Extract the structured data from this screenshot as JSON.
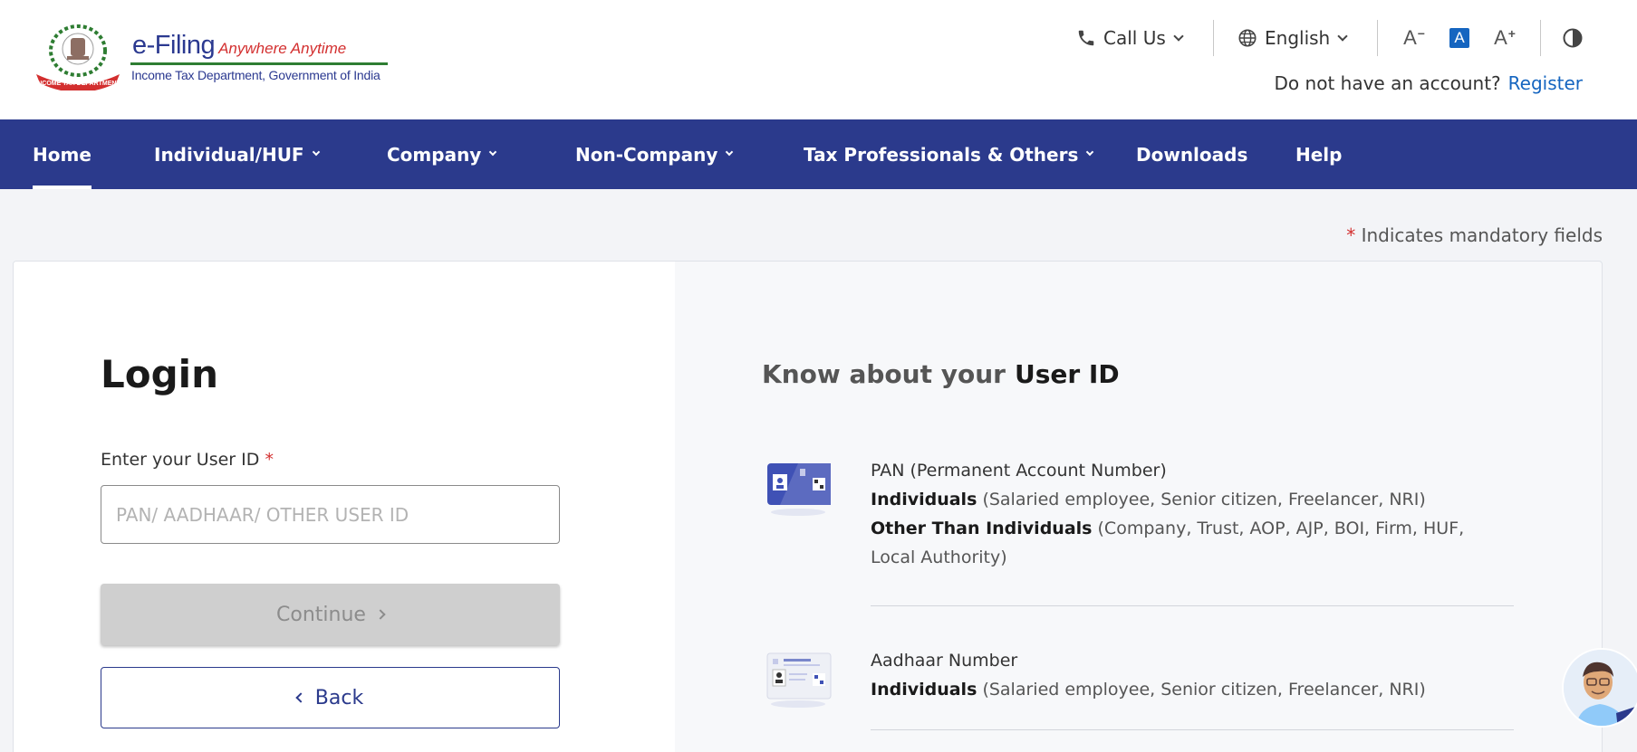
{
  "header": {
    "logo": {
      "title": "e-Filing",
      "tagline": "Anywhere Anytime",
      "subtitle": "Income Tax Department, Government of India",
      "emblem_ribbon_text": "INCOME TAX DEPARTMENT"
    },
    "call_us_label": "Call Us",
    "language_label": "English",
    "font_decrease_label": "A",
    "font_reset_label": "A",
    "font_increase_label": "A",
    "account_prompt": "Do not have an account?",
    "register_label": "Register"
  },
  "nav": {
    "items": [
      {
        "label": "Home",
        "active": true,
        "dropdown": false
      },
      {
        "label": "Individual/HUF",
        "dropdown": true
      },
      {
        "label": "Company",
        "dropdown": true
      },
      {
        "label": "Non-Company",
        "dropdown": true
      },
      {
        "label": "Tax Professionals & Others",
        "dropdown": true
      },
      {
        "label": "Downloads",
        "dropdown": false
      },
      {
        "label": "Help",
        "dropdown": false
      }
    ]
  },
  "main": {
    "mandatory_star": "*",
    "mandatory_note": "Indicates mandatory fields",
    "login": {
      "title": "Login",
      "user_id_label": "Enter your User ID",
      "required_star": "*",
      "user_id_value": "",
      "user_id_placeholder": "PAN/ AADHAAR/ OTHER USER ID",
      "continue_label": "Continue",
      "back_label": "Back"
    },
    "know": {
      "title_prefix": "Know about your",
      "title_emphasis": "User ID",
      "items": [
        {
          "heading": "PAN (Permanent Account Number)",
          "line1_bold": "Individuals",
          "line1_rest": "(Salaried employee, Senior citizen, Freelancer, NRI)",
          "line2_bold": "Other Than Individuals",
          "line2_rest": "(Company, Trust, AOP, AJP, BOI, Firm, HUF, Local Authority)"
        },
        {
          "heading": "Aadhaar Number",
          "line1_bold": "Individuals",
          "line1_rest": "(Salaried employee, Senior citizen, Freelancer, NRI)"
        }
      ]
    }
  },
  "colors": {
    "navbar": "#2b3a8c",
    "link": "#1565c0",
    "required": "#d32f2f",
    "disabled_button": "#cfcfcf"
  }
}
